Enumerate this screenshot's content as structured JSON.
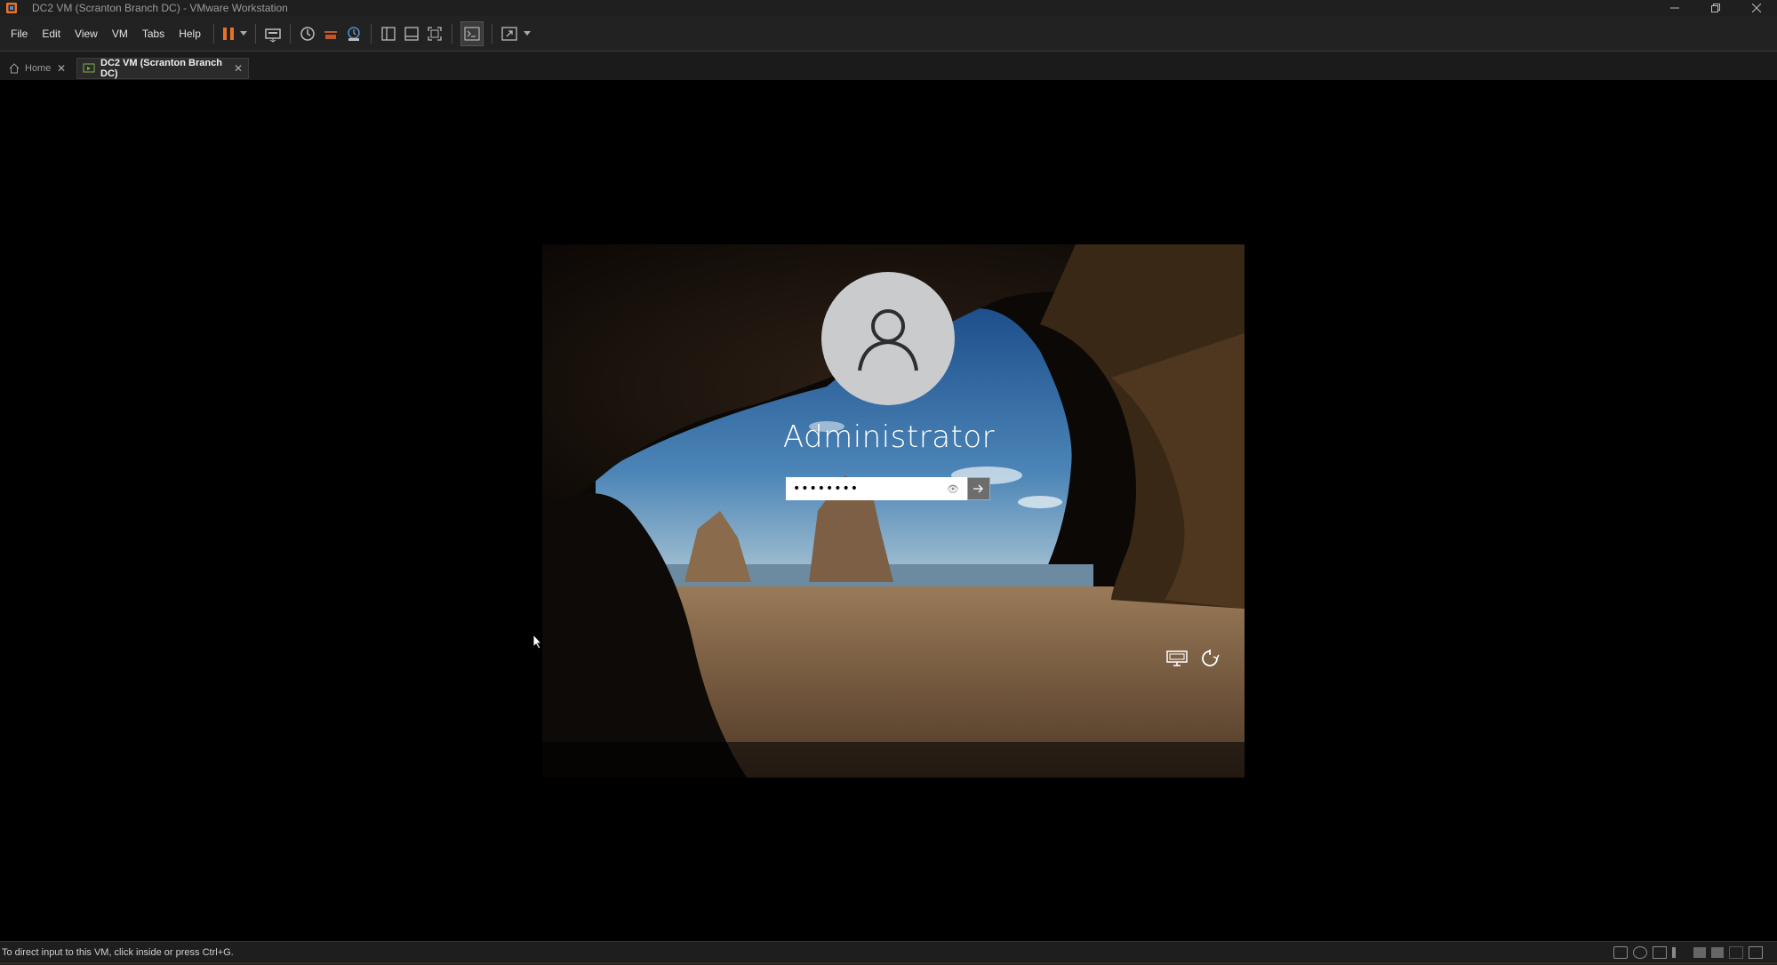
{
  "window": {
    "title": "DC2 VM (Scranton Branch DC) - VMware Workstation",
    "controls": {
      "minimize": "minimize-icon",
      "restore": "restore-icon",
      "close": "close-icon"
    }
  },
  "menu": [
    "File",
    "Edit",
    "View",
    "VM",
    "Tabs",
    "Help"
  ],
  "toolbar": {
    "icons": [
      "pause-icon",
      "dropdown-icon",
      "send-ctrl-alt-del-icon",
      "snapshot-icon",
      "revert-snapshot-icon",
      "snapshot-manager-icon",
      "library-icon",
      "thumbnail-bar-icon",
      "full-screen-icon",
      "console-view-icon",
      "stretch-icon",
      "dropdown-icon"
    ],
    "accent": "#e8712a"
  },
  "tabs": [
    {
      "label": "Home"
    },
    {
      "label": "DC2 VM (Scranton Branch DC)"
    }
  ],
  "lockscreen": {
    "user_name": "Administrator",
    "password_value": "••••••••",
    "icons": [
      "network-icon",
      "accessibility-icon"
    ]
  },
  "status": {
    "text": "To direct input to this VM, click inside or press Ctrl+G."
  }
}
